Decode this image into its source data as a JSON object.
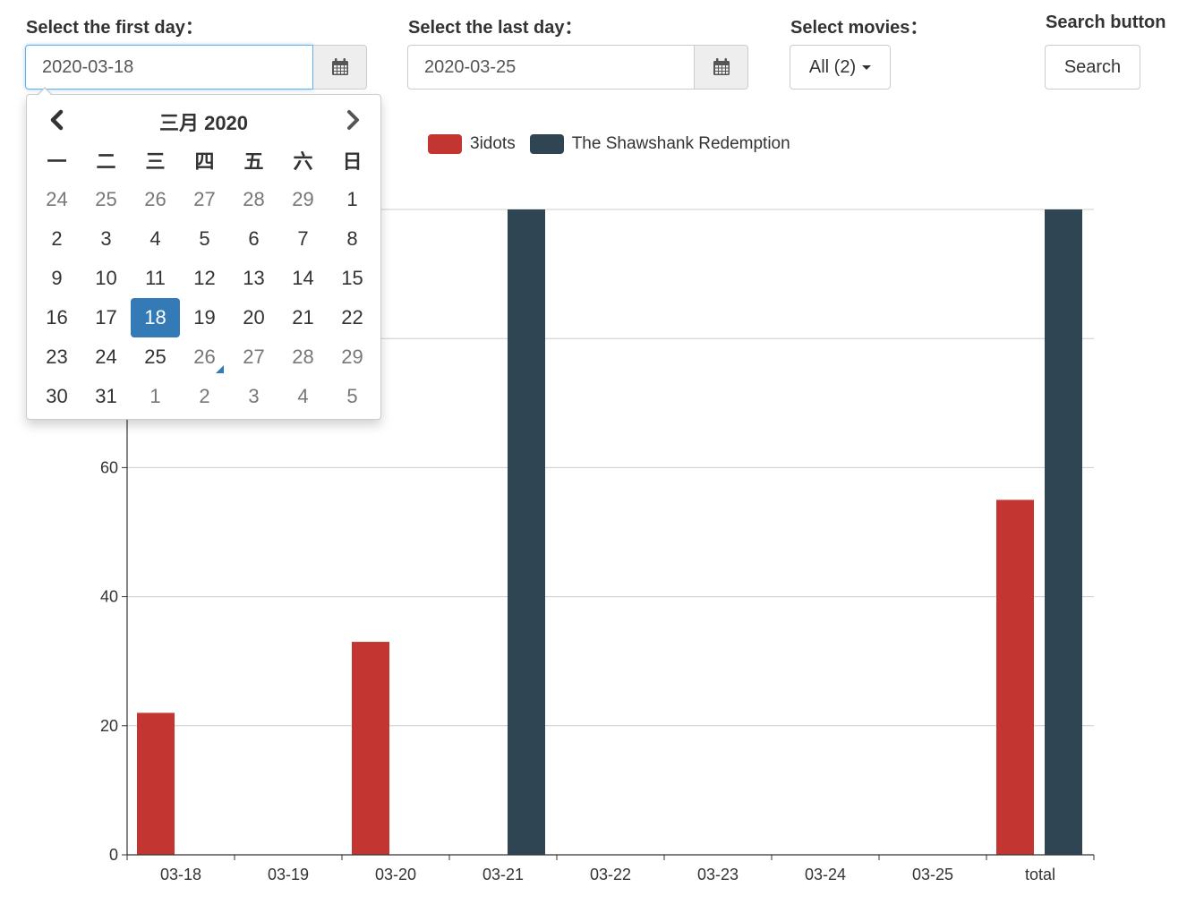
{
  "filters": {
    "first_day_label": "Select the first day：",
    "first_day_value": "2020-03-18",
    "last_day_label": "Select the last day：",
    "last_day_value": "2020-03-25",
    "movies_label": "Select movies：",
    "movies_value": "All (2)",
    "search_label": "Search button",
    "search_button": "Search"
  },
  "datepicker": {
    "month_title": "三月 2020",
    "weekdays": [
      "一",
      "二",
      "三",
      "四",
      "五",
      "六",
      "日"
    ],
    "weeks": [
      [
        "24",
        "25",
        "26",
        "27",
        "28",
        "29",
        "1"
      ],
      [
        "2",
        "3",
        "4",
        "5",
        "6",
        "7",
        "8"
      ],
      [
        "9",
        "10",
        "11",
        "12",
        "13",
        "14",
        "15"
      ],
      [
        "16",
        "17",
        "18",
        "19",
        "20",
        "21",
        "22"
      ],
      [
        "23",
        "24",
        "25",
        "26",
        "27",
        "28",
        "29"
      ],
      [
        "30",
        "31",
        "1",
        "2",
        "3",
        "4",
        "5"
      ]
    ],
    "selected": "18",
    "today": "26",
    "selected_color": "#337ab7"
  },
  "chart_data": {
    "type": "bar",
    "categories": [
      "03-18",
      "03-19",
      "03-20",
      "03-21",
      "03-22",
      "03-23",
      "03-24",
      "03-25",
      "total"
    ],
    "series": [
      {
        "name": "3idots",
        "color": "#c23531",
        "values": [
          22,
          0,
          33,
          0,
          0,
          0,
          0,
          0,
          55
        ]
      },
      {
        "name": "The Shawshank Redemption",
        "color": "#2f4554",
        "values": [
          0,
          0,
          0,
          100,
          0,
          0,
          0,
          0,
          100
        ]
      }
    ],
    "y_ticks": [
      0,
      20,
      40,
      60,
      80,
      100
    ],
    "ylim": [
      0,
      100
    ],
    "grid": true,
    "legend_position": "top"
  }
}
